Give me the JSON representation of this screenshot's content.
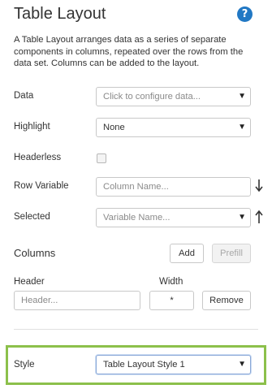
{
  "panel": {
    "title": "Table Layout",
    "help_icon": "question-circle-icon",
    "description": "A Table Layout arranges data as a series of separate components in columns, repeated over the rows from the data set. Columns can be added to the layout."
  },
  "fields": {
    "data": {
      "label": "Data",
      "placeholder": "Click to configure data..."
    },
    "highlight": {
      "label": "Highlight",
      "value": "None"
    },
    "headerless": {
      "label": "Headerless",
      "checked": false
    },
    "row_variable": {
      "label": "Row Variable",
      "placeholder": "Column Name...",
      "icon": "sort-down-arrow-icon"
    },
    "selected": {
      "label": "Selected",
      "placeholder": "Variable Name...",
      "icon": "sort-up-arrow-icon"
    }
  },
  "columns": {
    "title": "Columns",
    "add_label": "Add",
    "prefill_label": "Prefill",
    "header_label": "Header",
    "header_placeholder": "Header...",
    "width_label": "Width",
    "width_value": "*",
    "remove_label": "Remove"
  },
  "style": {
    "label": "Style",
    "value": "Table Layout Style 1",
    "highlight_color": "#8cc04b"
  },
  "colors": {
    "accent": "#2178c4",
    "highlight": "#8cc04b"
  }
}
